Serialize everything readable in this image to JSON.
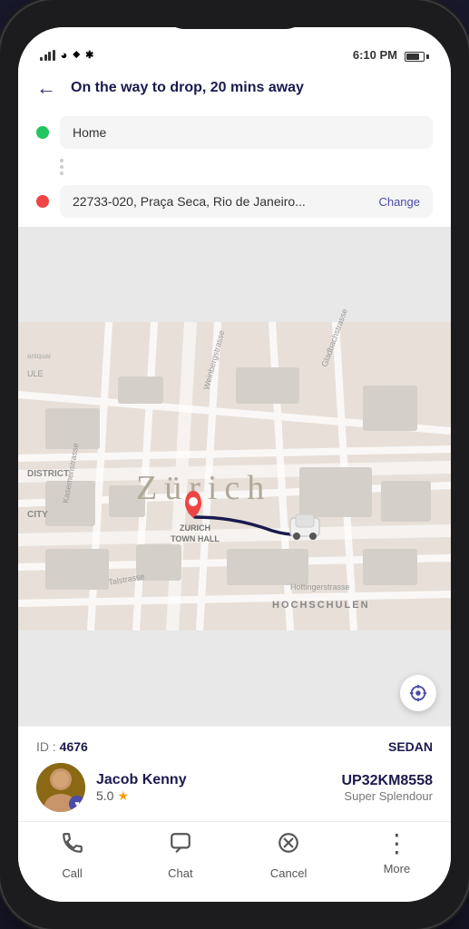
{
  "statusBar": {
    "left": {
      "signal": "signal",
      "wifi": "wifi",
      "location": "📍",
      "bluetooth": "bluetooth"
    },
    "time": "6:10 PM",
    "battery": 70
  },
  "header": {
    "back_label": "←",
    "title": "On the way to drop, 20 mins away"
  },
  "locations": {
    "origin_label": "Home",
    "destination_label": "22733-020, Praça Seca, Rio de Janeiro...",
    "change_label": "Change"
  },
  "map": {
    "city_label": "Zürich",
    "district_label": "DISTRICT",
    "city_area_label": "CITY",
    "town_hall_label": "ZURICH\nTOWN HALL",
    "hochschulen_label": "HOCHSCHULEN"
  },
  "driverCard": {
    "id_prefix": "ID : ",
    "id_number": "4676",
    "vehicle_type": "SEDAN",
    "driver_name": "Jacob Kenny",
    "rating": "5.0",
    "plate_number": "UP32KM8558",
    "vehicle_model": "Super Splendour"
  },
  "bottomNav": {
    "items": [
      {
        "id": "call",
        "icon": "☎",
        "label": "Call"
      },
      {
        "id": "chat",
        "icon": "💬",
        "label": "Chat"
      },
      {
        "id": "cancel",
        "icon": "⊗",
        "label": "Cancel"
      },
      {
        "id": "more",
        "icon": "⋮",
        "label": "More"
      }
    ]
  },
  "colors": {
    "accent": "#4b4ba8",
    "title_color": "#1a1a4e"
  }
}
